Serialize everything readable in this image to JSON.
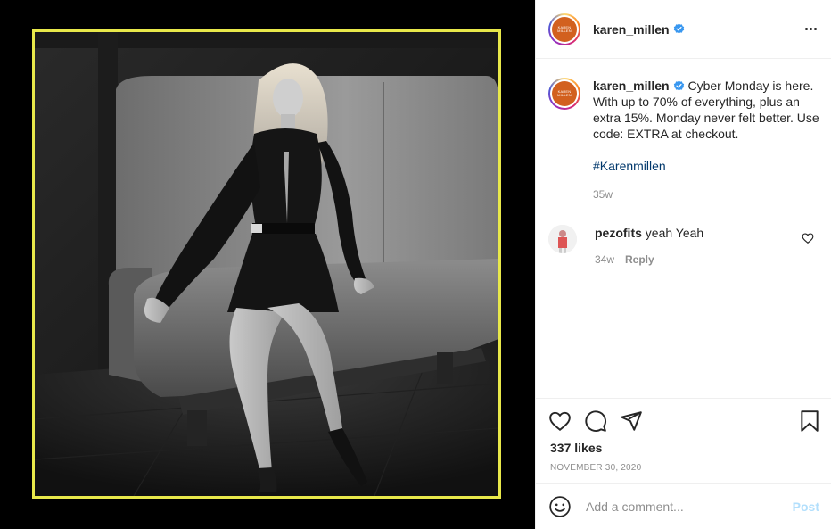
{
  "post": {
    "username": "karen_millen",
    "avatar_text": [
      "KAREN",
      "MILLEN"
    ],
    "caption": "Cyber Monday is here. With up to 70% of everything, plus an extra 15%. Monday never felt better. Use code: EXTRA at checkout.",
    "hashtag": "#Karenmillen",
    "caption_time": "35w",
    "likes": "337 likes",
    "date": "NOVEMBER 30, 2020"
  },
  "comments": [
    {
      "username": "pezofits",
      "text": "yeah Yeah",
      "time": "34w",
      "reply_label": "Reply"
    }
  ],
  "composer": {
    "placeholder": "Add a comment...",
    "post_label": "Post"
  },
  "colors": {
    "frame": "#e8e84a",
    "verified": "#3897f0",
    "brand_orange": "#d2601f",
    "post_disabled": "#b2dffc"
  },
  "icons": [
    "more-icon",
    "verified-icon",
    "heart-icon",
    "comment-icon",
    "share-icon",
    "bookmark-icon",
    "emoji-icon",
    "comment-like-icon"
  ]
}
